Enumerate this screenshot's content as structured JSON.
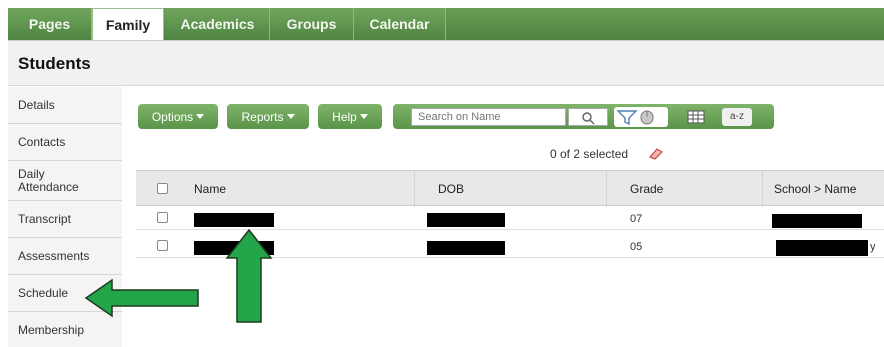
{
  "tabs": [
    {
      "label": "Pages"
    },
    {
      "label": "Family"
    },
    {
      "label": "Academics"
    },
    {
      "label": "Groups"
    },
    {
      "label": "Calendar"
    }
  ],
  "page_title": "Students",
  "sidebar": {
    "items": [
      {
        "label": "Details"
      },
      {
        "label": "Contacts"
      },
      {
        "label": "Daily\nAttendance"
      },
      {
        "label": "Transcript"
      },
      {
        "label": "Assessments"
      },
      {
        "label": "Schedule"
      },
      {
        "label": "Membership"
      }
    ]
  },
  "toolbar": {
    "options_label": "Options",
    "reports_label": "Reports",
    "help_label": "Help",
    "search_placeholder": "Search on Name",
    "az_label": "a-z"
  },
  "selection_info": "0 of 2 selected",
  "table": {
    "columns": [
      "Name",
      "DOB",
      "Grade",
      "School > Name"
    ],
    "rows": [
      {
        "grade": "07",
        "school_suffix": ""
      },
      {
        "grade": "05",
        "school_suffix": "y"
      }
    ]
  },
  "colors": {
    "tab_green": "#5a9449",
    "annotation_arrow": "#22a34a"
  }
}
